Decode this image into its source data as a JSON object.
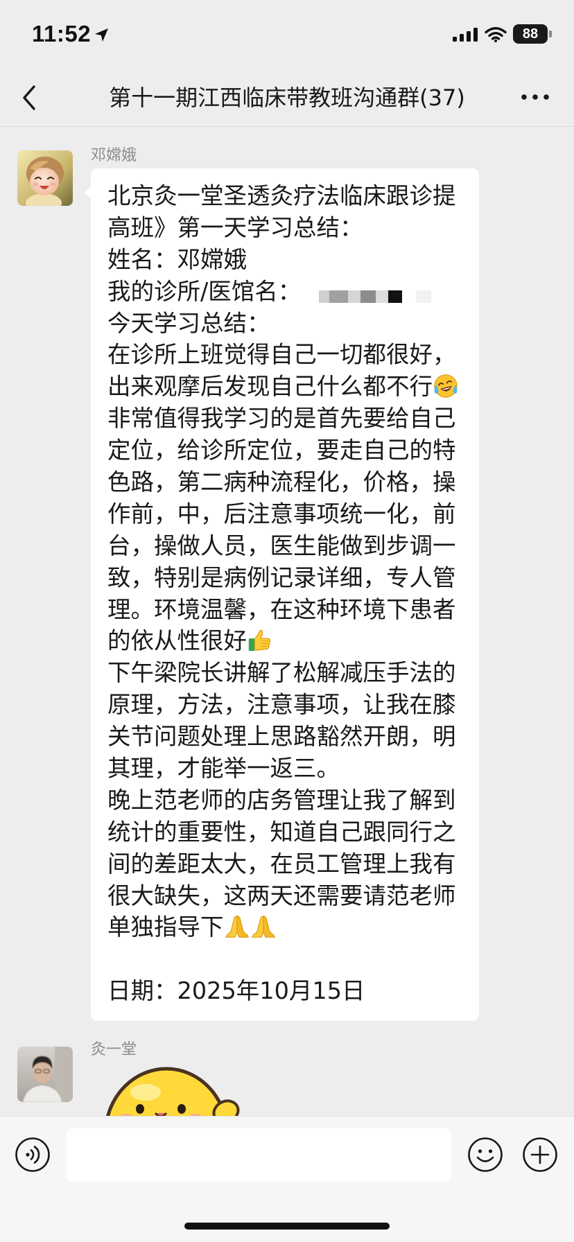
{
  "status_bar": {
    "time": "11:52",
    "battery_level": "88",
    "icons": [
      "location-arrow-icon",
      "cellular-signal-icon",
      "wifi-icon",
      "battery-icon"
    ]
  },
  "nav": {
    "title": "第十一期江西临床带教班沟通群(37)",
    "back_icon": "chevron-left-icon",
    "more_icon": "more-dots-icon"
  },
  "messages": [
    {
      "sender": "邓嫦娥",
      "avatar_icon": "baby-avatar-icon",
      "lines": [
        {
          "text": "北京灸一堂圣透灸疗法临床跟诊提"
        },
        {
          "text": "高班》第一天学习总结："
        },
        {
          "text": "姓名：邓嫦娥"
        },
        {
          "text": "我的诊所/医馆名："
        },
        {
          "text": "今天学习总结："
        },
        {
          "text": "在诊所上班觉得自己一切都很好，"
        },
        {
          "text": "出来观摩后发现自己什么都不行",
          "emoji": [
            "tears-of-joy-icon"
          ]
        },
        {
          "text": "非常值得我学习的是首先要给自己"
        },
        {
          "text": "定位，给诊所定位，要走自己的特"
        },
        {
          "text": "色路，第二病种流程化，价格，操"
        },
        {
          "text": "作前，中，后注意事项统一化，前"
        },
        {
          "text": "台，操做人员，医生能做到步调一"
        },
        {
          "text": "致，特别是病例记录详细，专人管"
        },
        {
          "text": "理。环境温馨，在这种环境下患者"
        },
        {
          "text": "的依从性很好",
          "emoji": [
            "thumbs-up-icon"
          ]
        },
        {
          "text": "下午梁院长讲解了松解减压手法的"
        },
        {
          "text": "原理，方法，注意事项，让我在膝"
        },
        {
          "text": "关节问题处理上思路豁然开朗，明"
        },
        {
          "text": "其理，才能举一返三。"
        },
        {
          "text": "晚上范老师的店务管理让我了解到"
        },
        {
          "text": "统计的重要性，知道自己跟同行之"
        },
        {
          "text": "间的差距太大，在员工管理上我有"
        },
        {
          "text": "很大缺失，这两天还需要请范老师"
        },
        {
          "text": "单独指导下",
          "emoji": [
            "folded-hands-icon",
            "folded-hands-icon"
          ]
        },
        {
          "text": ""
        },
        {
          "text": "日期：2025年10月15日"
        }
      ]
    },
    {
      "sender": "灸一堂",
      "avatar_icon": "person-avatar-icon",
      "sticker_icon": "yellow-chick-sticker-icon"
    }
  ],
  "input_bar": {
    "text": "",
    "icons": [
      "voice-icon",
      "smiley-icon",
      "plus-icon"
    ]
  },
  "colors": {
    "background": "#ededed",
    "bubble": "#ffffff",
    "text": "#191919",
    "sender_name": "#8c8c8c",
    "input_bar": "#f6f6f6"
  }
}
